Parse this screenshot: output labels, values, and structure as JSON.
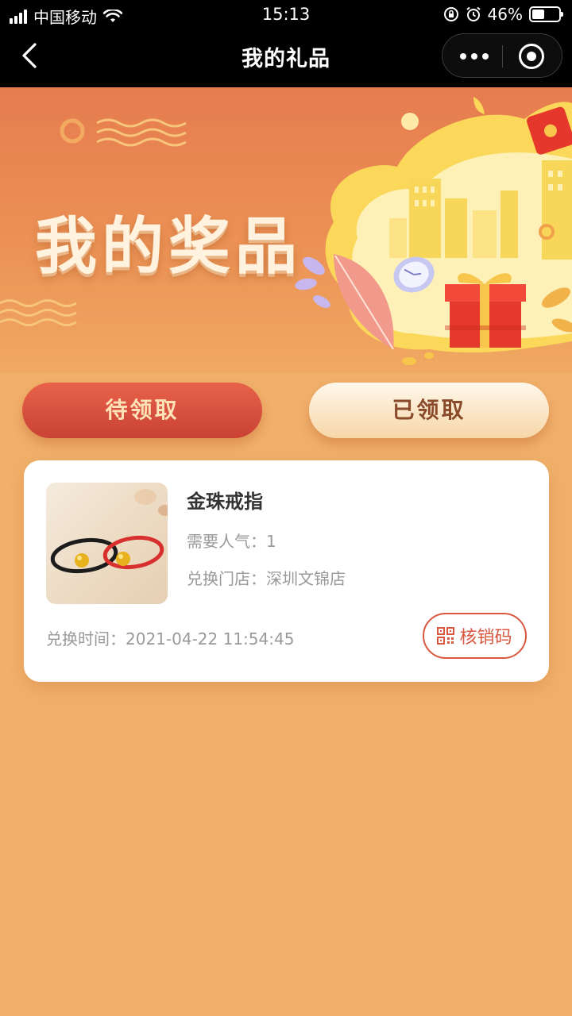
{
  "status_bar": {
    "carrier": "中国移动",
    "time": "15:13",
    "battery_percent": "46%",
    "battery_level": 0.46
  },
  "nav": {
    "title": "我的礼品"
  },
  "banner": {
    "title": "我的奖品"
  },
  "tabs": [
    {
      "label": "待领取",
      "active": true
    },
    {
      "label": "已领取",
      "active": false
    }
  ],
  "gifts": [
    {
      "name": "金珠戒指",
      "popularity_label": "需要人气：",
      "popularity_value": "1",
      "store_label": "兑换门店：",
      "store_value": "深圳文锦店",
      "time_label": "兑换时间：",
      "time_value": "2021-04-22 11:54:45",
      "action_label": "核销码"
    }
  ],
  "colors": {
    "accent": "#d9573f",
    "background": "#f0b06a",
    "nav_bar": "#000000"
  }
}
